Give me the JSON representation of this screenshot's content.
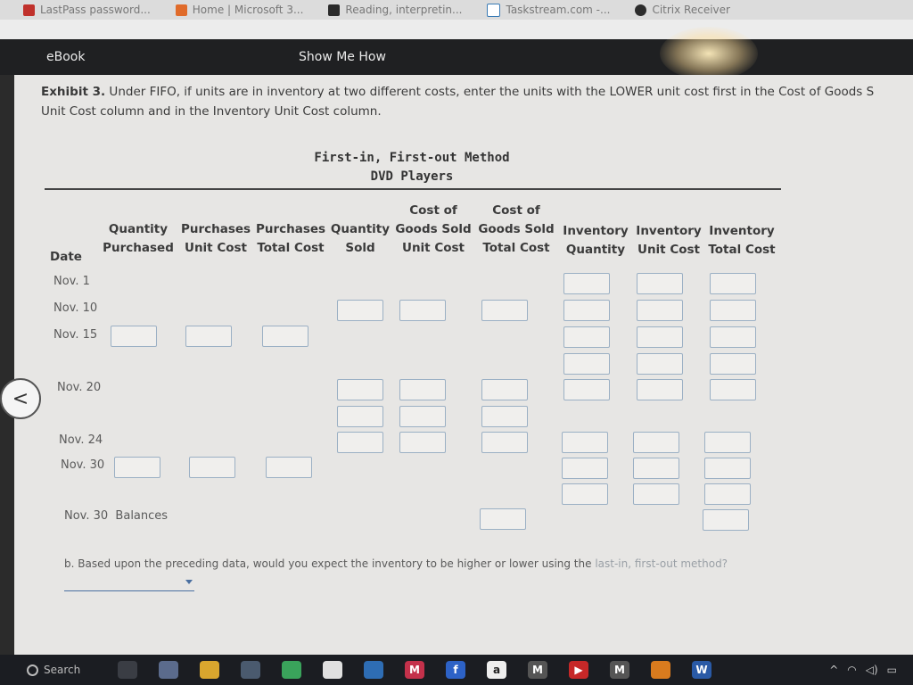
{
  "bookmarks": [
    {
      "label": "LastPass password...",
      "color": "#c0312b"
    },
    {
      "label": "Home | Microsoft 3...",
      "color": "#e06b2a"
    },
    {
      "label": "Reading, interpretin...",
      "color": "#2a2a2a"
    },
    {
      "label": "Taskstream.com -...",
      "color": "#3a7bb5"
    },
    {
      "label": "Citrix Receiver",
      "color": "#2d2d2d"
    }
  ],
  "header": {
    "ebook": "eBook",
    "show_me_how": "Show Me How"
  },
  "exhibit": {
    "prefix": "Exhibit 3.",
    "line1": " Under FIFO, if units are in inventory at two different costs, enter the units with the LOWER unit cost first in the Cost of Goods S",
    "line2": "Unit Cost column and in the Inventory Unit Cost column."
  },
  "table": {
    "title": "First-in, First-out Method",
    "subtitle": "DVD Players",
    "headers": {
      "date": "Date",
      "qty_purchased": [
        "Quantity",
        "Purchased"
      ],
      "purch_unit_cost": [
        "Purchases",
        "Unit Cost"
      ],
      "purch_total_cost": [
        "Purchases",
        "Total Cost"
      ],
      "qty_sold": [
        "Quantity",
        "Sold"
      ],
      "cogs_unit_cost": [
        "Cost of",
        "Goods Sold",
        "Unit Cost"
      ],
      "cogs_total_cost": [
        "Cost of",
        "Goods Sold",
        "Total Cost"
      ],
      "inv_quantity": [
        "Inventory",
        "Quantity"
      ],
      "inv_unit_cost": [
        "Inventory",
        "Unit Cost"
      ],
      "inv_total_cost": [
        "Inventory",
        "Total Cost"
      ]
    },
    "dates": [
      "Nov. 1",
      "Nov. 10",
      "Nov. 15",
      "Nov. 20",
      "Nov. 24",
      "Nov. 30",
      "Nov. 30  Balances"
    ]
  },
  "question": {
    "text": "b.  Based upon the preceding data, would you expect the inventory to be higher or lower using the ",
    "faded": "last-in, first-out method?"
  },
  "taskbar": {
    "search": "Search",
    "apps": [
      {
        "name": "task-view",
        "color": "#3a3d44",
        "label": ""
      },
      {
        "name": "store",
        "color": "#5b6b8c",
        "label": ""
      },
      {
        "name": "file-explorer",
        "color": "#d9a62e",
        "label": ""
      },
      {
        "name": "calendar",
        "color": "#4a5a6e",
        "label": ""
      },
      {
        "name": "chrome",
        "color": "#3aa35b",
        "label": ""
      },
      {
        "name": "app-white",
        "color": "#e0e0e0",
        "label": ""
      },
      {
        "name": "app-blue",
        "color": "#2e6db4",
        "label": ""
      },
      {
        "name": "mcafee",
        "color": "#c4314b",
        "label": "M"
      },
      {
        "name": "facebook",
        "color": "#2d62c6",
        "label": "f"
      },
      {
        "name": "amazon",
        "color": "#eeeeee",
        "label": "a"
      },
      {
        "name": "app-gray",
        "color": "#555",
        "label": "M"
      },
      {
        "name": "youtube",
        "color": "#c62828",
        "label": "▶"
      },
      {
        "name": "app-gray2",
        "color": "#555",
        "label": "M"
      },
      {
        "name": "app-orange",
        "color": "#d97b1e",
        "label": ""
      },
      {
        "name": "word",
        "color": "#2a5aa6",
        "label": "W"
      }
    ],
    "tray": [
      "^",
      "wifi",
      "vol",
      "batt"
    ]
  }
}
